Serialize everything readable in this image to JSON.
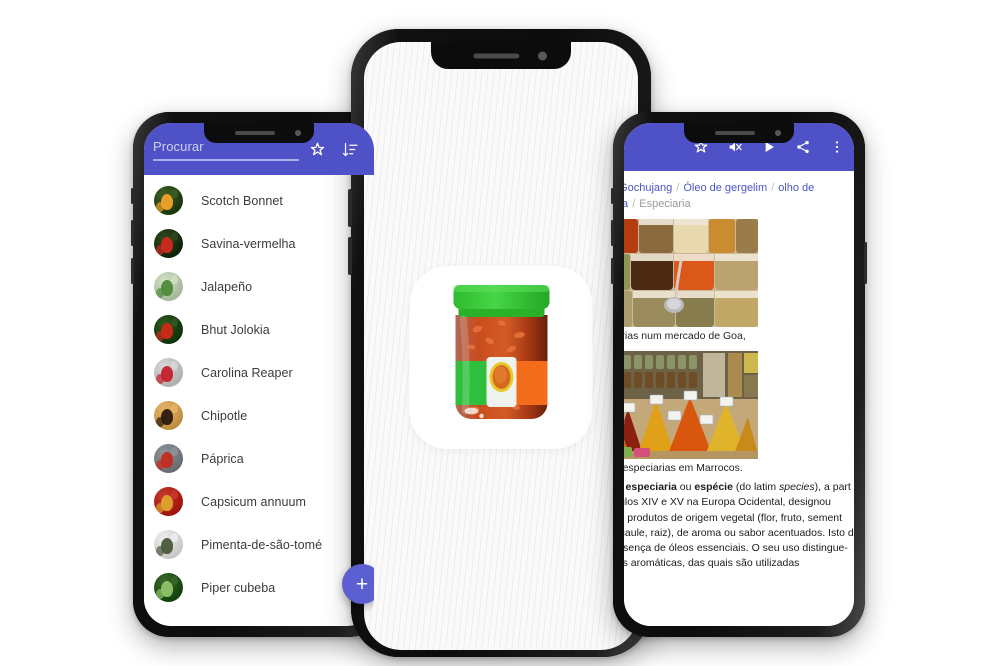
{
  "scene": {
    "background": "#ffffff",
    "accent_blue": "#4f51c6",
    "fab_color": "#5c5fd1"
  },
  "left_phone": {
    "name": "phone-left",
    "appbar": {
      "search_placeholder": "Procurar",
      "search_value": "",
      "icons": [
        {
          "name": "star-outline-icon",
          "label": "Favoritos"
        },
        {
          "name": "sort-icon",
          "label": "Ordenar"
        }
      ]
    },
    "fab": {
      "label": "+",
      "name": "add-fab"
    },
    "list_items": [
      {
        "label": "Scotch Bonnet"
      },
      {
        "label": "Savina-vermelha"
      },
      {
        "label": "Jalapeño"
      },
      {
        "label": "Bhut Jolokia"
      },
      {
        "label": "Carolina Reaper"
      },
      {
        "label": "Chipotle"
      },
      {
        "label": "Páprica"
      },
      {
        "label": "Capsicum annuum"
      },
      {
        "label": "Pimenta-de-são-tomé"
      },
      {
        "label": "Piper cubeba"
      }
    ]
  },
  "center_phone": {
    "name": "phone-center",
    "app_icon": {
      "name": "sauce-jar-app-icon",
      "lid_color": "#3fc63f",
      "sauce_color": "#c23a10"
    }
  },
  "right_phone": {
    "name": "phone-right",
    "appbar": {
      "icons": [
        {
          "name": "star-outline-icon",
          "label": "Favorito"
        },
        {
          "name": "volume-off-icon",
          "label": "Sem som"
        },
        {
          "name": "play-icon",
          "label": "Reproduzir"
        },
        {
          "name": "share-icon",
          "label": "Partilhar"
        },
        {
          "name": "overflow-menu-icon",
          "label": "Mais"
        }
      ]
    },
    "breadcrumb": [
      {
        "text": "Gochujang",
        "muted": false
      },
      {
        "text": "Óleo de gergelim",
        "muted": false
      },
      {
        "text": "olho de soja",
        "muted": false
      },
      {
        "text": "Especiaria",
        "muted": true
      }
    ],
    "figures": [
      {
        "name": "goa-spice-market-photo",
        "caption": "ciarias num mercado de Goa,"
      },
      {
        "name": "morocco-spice-market-photo",
        "caption": "de especiarias em Marrocos."
      }
    ],
    "body_lines": [
      "mo <b>especiaria</b> ou <b>espécie</b> (do latim <i>species</i>), a part",
      "éculos XIV e XV na Europa Ocidental, designou",
      "sos produtos de origem vegetal (flor, fruto, sement",
      "a, caule, raiz), de aroma ou sabor acentuados. Isto d",
      "presença de óleos essenciais. O seu uso distingue-",
      "rvas aromáticas, das quais são utilizadas"
    ]
  }
}
